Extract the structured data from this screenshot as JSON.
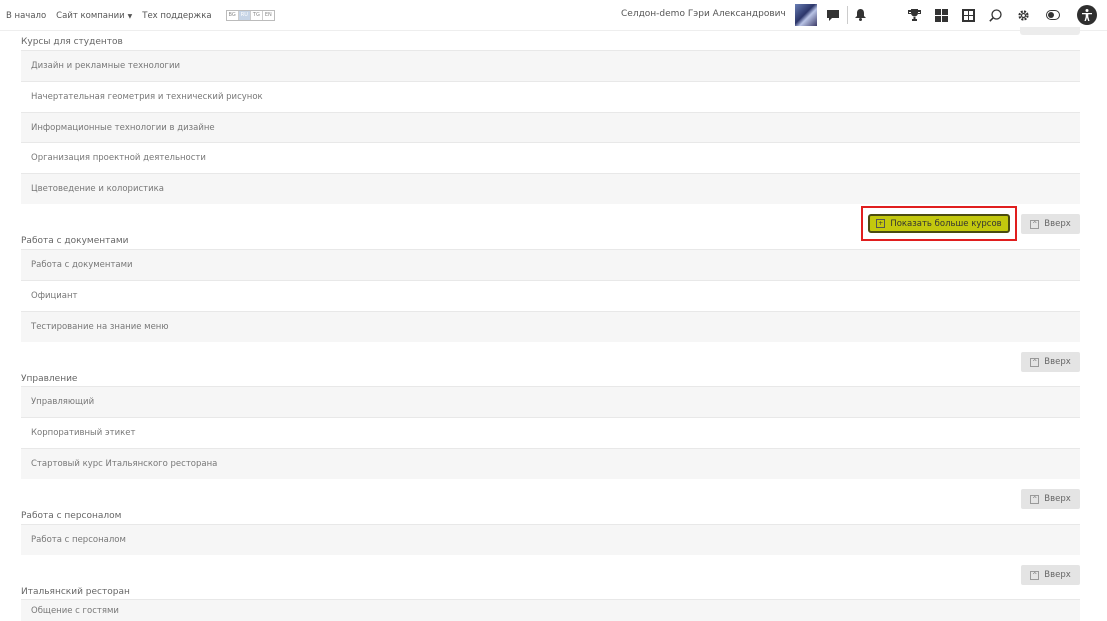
{
  "nav": {
    "home": "В начало",
    "company_site": "Сайт компании",
    "support": "Тех поддержка",
    "langs": [
      "BG",
      "RU",
      "TG",
      "EN"
    ],
    "active_lang": "RU"
  },
  "user": {
    "name": "Селдон-demo Гэри Александрович"
  },
  "icons": [
    "chat-icon",
    "bell-icon",
    "trophy-icon",
    "grid-icon",
    "catalog-icon",
    "search-icon",
    "gear-icon",
    "theme-toggle-icon",
    "accessibility-icon"
  ],
  "sections": [
    {
      "title": "Курсы для студентов",
      "courses": [
        "Дизайн и рекламные технологии",
        "Начертательная геометрия и технический рисунок",
        "Информационные технологии в дизайне",
        "Организация проектной деятельности",
        "Цветоведение и колористика"
      ]
    },
    {
      "title": "Работа с документами",
      "courses": [
        "Работа с документами",
        "Официант",
        "Тестирование на знание меню"
      ]
    },
    {
      "title": "Управление",
      "courses": [
        "Управляющий",
        "Корпоративный этикет",
        "Стартовый курс Итальянского ресторана"
      ]
    },
    {
      "title": "Работа с персоналом",
      "courses": [
        "Работа с персоналом"
      ]
    },
    {
      "title": "Итальянский ресторан",
      "courses": [
        "Общение с гостями"
      ]
    }
  ],
  "buttons": {
    "show_more": "Показать больше курсов",
    "up": "Вверх"
  },
  "colors": {
    "show_more_bg": "#c3c80e",
    "highlight_border": "#e01e1e",
    "up_bg": "#e4e4e4"
  }
}
